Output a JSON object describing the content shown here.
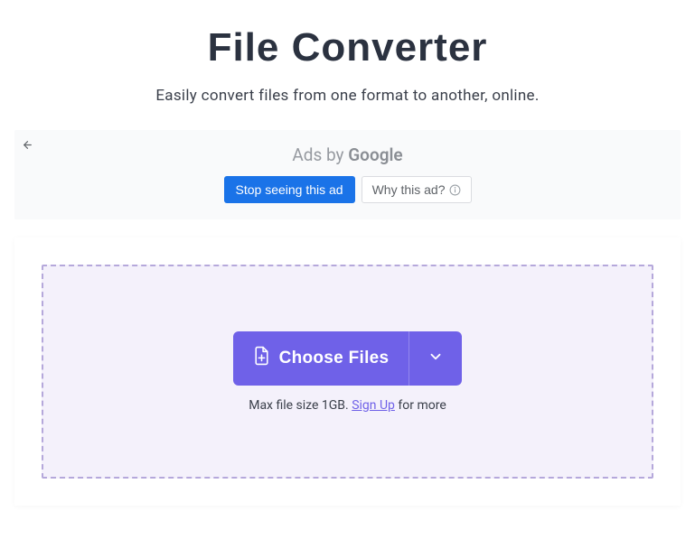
{
  "hero": {
    "title": "File Converter",
    "subtitle": "Easily convert files from one format to another, online."
  },
  "ad": {
    "prefix": "Ads by ",
    "brand": "Google",
    "stop_label": "Stop seeing this ad",
    "why_label": "Why this ad?"
  },
  "dropzone": {
    "choose_files_label": "Choose Files",
    "note_prefix": "Max file size 1GB. ",
    "signup_label": "Sign Up",
    "note_suffix": " for more"
  }
}
